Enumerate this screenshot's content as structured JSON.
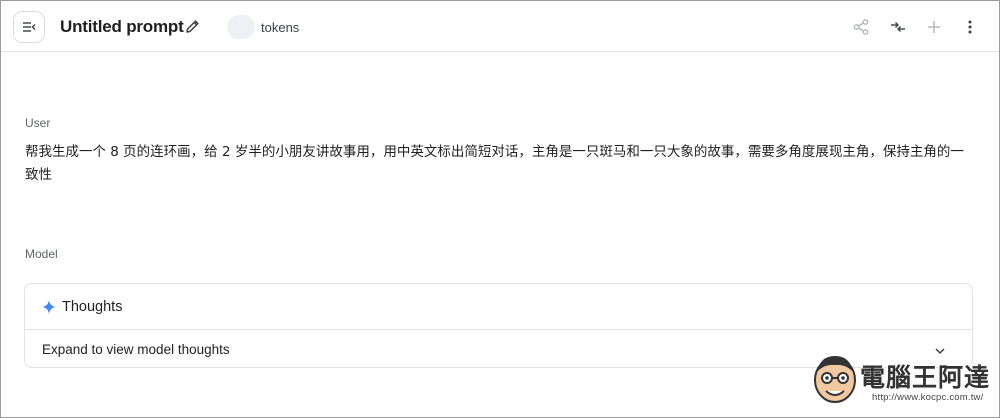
{
  "header": {
    "title": "Untitled prompt",
    "tokens_label": "tokens"
  },
  "icons": {
    "menu": "collapse-menu-icon",
    "edit": "pencil-icon",
    "share": "share-icon",
    "compare": "compare-arrows-icon",
    "add": "plus-icon",
    "more": "more-vert-icon",
    "thoughts": "sparkle-icon",
    "expand": "chevron-down-icon"
  },
  "conversation": {
    "user_role": "User",
    "user_message": "帮我生成一个 8 页的连环画，给 2 岁半的小朋友讲故事用，用中英文标出简短对话，主角是一只斑马和一只大象的故事，需要多角度展现主角，保持主角的一致性",
    "model_role": "Model",
    "thoughts_title": "Thoughts",
    "thoughts_expand": "Expand to view model thoughts"
  },
  "watermark": {
    "title": "電腦王阿達",
    "url": "http://www.kocpc.com.tw/"
  },
  "colors": {
    "accent_sparkle": "#4285f4",
    "text": "#1f1f1f",
    "muted": "#5f6368",
    "border": "#e3e3e3"
  }
}
